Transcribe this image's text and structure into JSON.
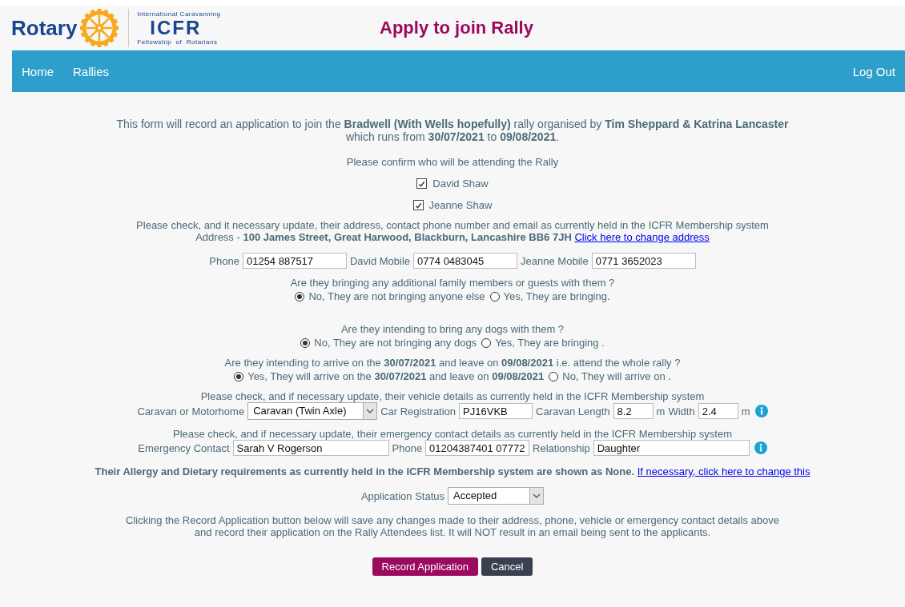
{
  "header": {
    "brand": "Rotary",
    "club": {
      "top": "International Caravanning",
      "name": "ICFR",
      "bottom": "Fellowship  of  Rotarians"
    },
    "title": "Apply to join Rally"
  },
  "nav": {
    "items": [
      "Home",
      "Rallies"
    ],
    "logout": "Log Out"
  },
  "intro": [
    "This form will record an application to join the **Bradwell (With Wells hopefully)** rally organised by **Tim Sheppard & Katrina Lancaster**",
    "which runs from **30/07/2021** to **09/08/2021**."
  ],
  "attend_prompt": "Please confirm who will be attending the Rally",
  "attendees": [
    {
      "name": "David Shaw",
      "checked": true
    },
    {
      "name": "Jeanne Shaw",
      "checked": true
    }
  ],
  "contact_note": "Please check, and it necessary update, their address, contact phone number and email as currently held in the ICFR Membership system",
  "address": {
    "text": "Address - **100 James Street, Great Harwood, Blackburn, Lancashire BB6 7JH**",
    "link": "Click here to change address"
  },
  "phones": [
    {
      "label": "Phone",
      "value": "01254 887517"
    },
    {
      "label": "David Mobile",
      "value": "0774 0483045"
    },
    {
      "label": "Jeanne Mobile",
      "value": "0771 3652023"
    }
  ],
  "questions": [
    {
      "text": "Are they bringing any additional family members or guests with them ?",
      "options": [
        {
          "label": "No, They are not bringing anyone else",
          "selected": true
        },
        {
          "label": "Yes, They are bringing.",
          "selected": false
        }
      ]
    },
    {
      "text": "Are they intending to bring any dogs with them ?",
      "options": [
        {
          "label": "No, They are not bringing any dogs",
          "selected": true
        },
        {
          "label": "Yes, They are bringing .",
          "selected": false
        }
      ]
    },
    {
      "text": "Are they intending to arrive on the **30/07/2021** and leave on **09/08/2021** i.e. attend the whole rally ?",
      "options": [
        {
          "label": "Yes, They will arrive on the **30/07/2021** and leave on **09/08/2021**",
          "selected": true
        },
        {
          "label": "No, They will arrive on .",
          "selected": false
        }
      ]
    }
  ],
  "vehicle": {
    "note": "Please check, and if necessary update, their vehicle details as currently held in the ICFR Membership system",
    "items": [
      {
        "kind": "label",
        "text": "Caravan or Motorhome"
      },
      {
        "kind": "select",
        "value": "Caravan (Twin Axle)"
      },
      {
        "kind": "label",
        "text": "Car Registration"
      },
      {
        "kind": "input",
        "value": "PJ16VKB"
      },
      {
        "kind": "label",
        "text": "Caravan Length"
      },
      {
        "kind": "short",
        "value": "8.2"
      },
      {
        "kind": "label",
        "text": "m"
      },
      {
        "kind": "label",
        "text": "Width"
      },
      {
        "kind": "short",
        "value": "2.4"
      },
      {
        "kind": "label",
        "text": "m"
      },
      {
        "kind": "info"
      }
    ]
  },
  "emergency": {
    "note": "Please check, and if necessary update, their emergency contact details as currently held in the ICFR Membership system",
    "items": [
      {
        "kind": "label",
        "text": "Emergency Contact"
      },
      {
        "kind": "wide",
        "value": "Sarah V Rogerson"
      },
      {
        "kind": "label",
        "text": "Phone"
      },
      {
        "kind": "medium",
        "value": "01204387401 07772"
      },
      {
        "kind": "label",
        "text": "Relationship"
      },
      {
        "kind": "wide",
        "value": "Daughter"
      },
      {
        "kind": "info"
      }
    ]
  },
  "allergy": {
    "text": "Their Allergy and Dietary requirements as currently held in the ICFR Membership system are shown as None.",
    "link": "If necessary, click here to change this"
  },
  "status": {
    "label": "Application Status",
    "value": "Accepted"
  },
  "footer_note": [
    "Clicking the Record Application button below will save any changes made to their address, phone, vehicle or emergency contact details above",
    "and record their application on the Rally Attendees list. It will NOT result in an email being sent to the applicants."
  ],
  "buttons": [
    {
      "label": "Record Application",
      "kind": "primary"
    },
    {
      "label": "Cancel",
      "kind": "secondary"
    }
  ]
}
